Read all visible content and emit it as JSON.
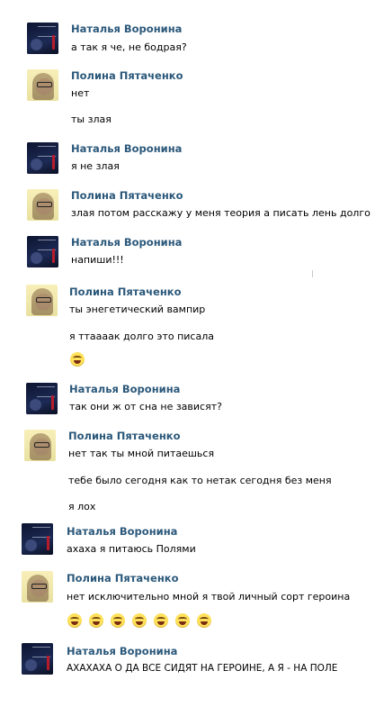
{
  "users": {
    "natalya": "Наталья Воронина",
    "polina": "Полина Пятаченко"
  },
  "messages": [
    {
      "author": "Наталья Воронина",
      "lines": [
        "а так я че, не бодрая?"
      ]
    },
    {
      "author": "Полина Пятаченко",
      "lines": [
        "нет",
        "ты злая"
      ]
    },
    {
      "author": "Наталья Воронина",
      "lines": [
        "я не злая"
      ]
    },
    {
      "author": "Полина Пятаченко",
      "lines": [
        "злая потом расскажу у меня теория а писать лень долго"
      ]
    },
    {
      "author": "Наталья Воронина",
      "lines": [
        "напиши!!!"
      ]
    },
    {
      "author": "Полина Пятаченко",
      "lines": [
        "ты энегетический вампир",
        "я ттаааак долго это писала"
      ],
      "emoji_count": 1
    },
    {
      "author": "Наталья Воронина",
      "lines": [
        "так они ж от сна не зависят?"
      ]
    },
    {
      "author": "Полина Пятаченко",
      "lines": [
        "нет так ты мной питаешься",
        "тебе было сегодня как то нетак сегодня без меня",
        "я лох"
      ]
    },
    {
      "author": "Наталья Воронина",
      "lines": [
        "ахаха я питаюсь Полями"
      ]
    },
    {
      "author": "Полина Пятаченко",
      "lines": [
        "нет исключительно мной я твой личный сорт героина"
      ],
      "emoji_count": 7
    },
    {
      "author": "Наталья Воронина",
      "lines": [
        "АХАХАХА О ДА ВСЕ СИДЯТ НА ГЕРОИНЕ, А Я - НА ПОЛЕ"
      ]
    }
  ],
  "emoji_name": "tears-of-joy-icon"
}
